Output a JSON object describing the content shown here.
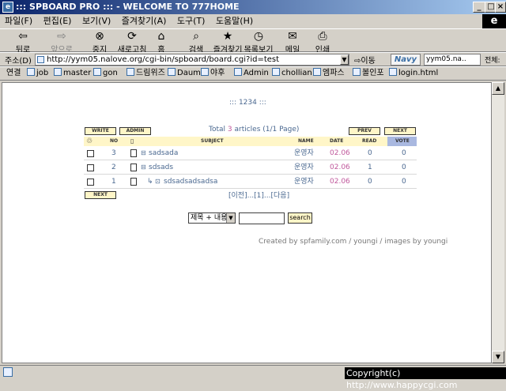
{
  "window": {
    "title": "::: SPBOARD PRO ::: - WELCOME TO 777HOME",
    "min": "_",
    "max": "□",
    "close": "×"
  },
  "menu": [
    "파일(F)",
    "편집(E)",
    "보기(V)",
    "즐겨찾기(A)",
    "도구(T)",
    "도움말(H)"
  ],
  "toolbar": {
    "back": "뒤로",
    "forward": "앞으로",
    "stop": "중지",
    "refresh": "새로고침",
    "home": "홈",
    "search": "검색",
    "favorites": "즐겨찾기",
    "history": "목록보기",
    "mail": "메일",
    "print": "인쇄"
  },
  "address": {
    "label": "주소(D)",
    "url": "http://yym05.nalove.org/cgi-bin/spboard/board.cgi?id=test",
    "go": "이동",
    "navy": "Navy",
    "navy_text": "yym05.na..",
    "all": "전체:"
  },
  "links": {
    "label": "연결",
    "items": [
      "job",
      "master",
      "gon",
      "드림위즈",
      "Daum",
      "야후",
      "Admin",
      "chollian",
      "엠파스",
      "볼인포",
      "login.html"
    ]
  },
  "board": {
    "page_title": "::: 1234 :::",
    "write": "WRITE",
    "admin": "ADMIN",
    "summary_prefix": "Total ",
    "total": "3",
    "summary_suffix": " articles (1/1 Page)",
    "prev": "PREV",
    "next": "NEXT",
    "next_bottom": "NEXT",
    "headers": {
      "no": "NO",
      "subject": "SUBJECT",
      "name": "NAME",
      "date": "DATE",
      "read": "READ",
      "vote": "VOTE"
    },
    "rows": [
      {
        "no": "3",
        "subject": "sadsada",
        "name": "운영자",
        "date": "02.06",
        "read": "0",
        "vote": "0"
      },
      {
        "no": "2",
        "subject": "sdsads",
        "name": "운영자",
        "date": "02.06",
        "read": "1",
        "vote": "0"
      },
      {
        "no": "1",
        "subject": "sdsadsadsadsa",
        "name": "운영자",
        "date": "02.06",
        "read": "0",
        "vote": "0"
      }
    ],
    "pager": "[이전]...[1]...[다음]",
    "search_option": "제목 + 내용",
    "search_value": "",
    "search_button": "search",
    "credit": "Created by spfamily.com / youngi / images by youngi"
  },
  "copyright": "Copyright(c) http://www.happycgi.com"
}
